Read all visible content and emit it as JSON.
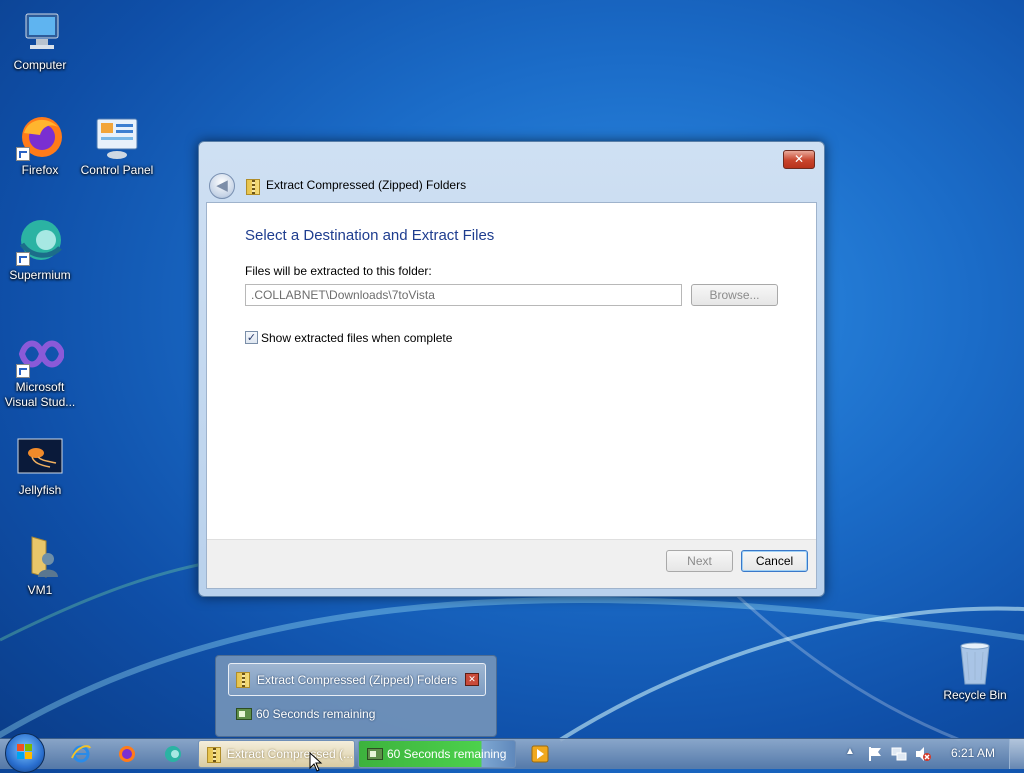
{
  "desktop": {
    "icons": [
      {
        "label": "Computer"
      },
      {
        "label": "Firefox"
      },
      {
        "label": "Control Panel"
      },
      {
        "label": "Supermium"
      },
      {
        "label": "Microsoft Visual Stud..."
      },
      {
        "label": "Jellyfish"
      },
      {
        "label": "VM1"
      },
      {
        "label": "Recycle Bin"
      }
    ]
  },
  "wizard": {
    "title": "Extract Compressed (Zipped) Folders",
    "close_symbol": "✕",
    "heading": "Select a Destination and Extract Files",
    "folder_label": "Files will be extracted to this folder:",
    "path_value": ".COLLABNET\\Downloads\\7toVista",
    "browse_label": "Browse...",
    "show_files_checked": true,
    "show_files_label": "Show extracted files when complete",
    "next_label": "Next",
    "cancel_label": "Cancel"
  },
  "thumbnail_popup": {
    "item_title": "Extract Compressed (Zipped) Folders",
    "timer_text": "60 Seconds remaining"
  },
  "taskbar": {
    "extract_task_label": "Extract Compressed (...",
    "timer_task_label": "60 Seconds remaining",
    "clock": "6:21 AM",
    "tray_icons": [
      "chevron-up-icon",
      "action-center-flag-icon",
      "network-icon",
      "volume-muted-icon"
    ]
  },
  "colors": {
    "heading_blue": "#1e3d8f",
    "close_red": "#c8442c",
    "progress_green": "#4cd14c"
  }
}
